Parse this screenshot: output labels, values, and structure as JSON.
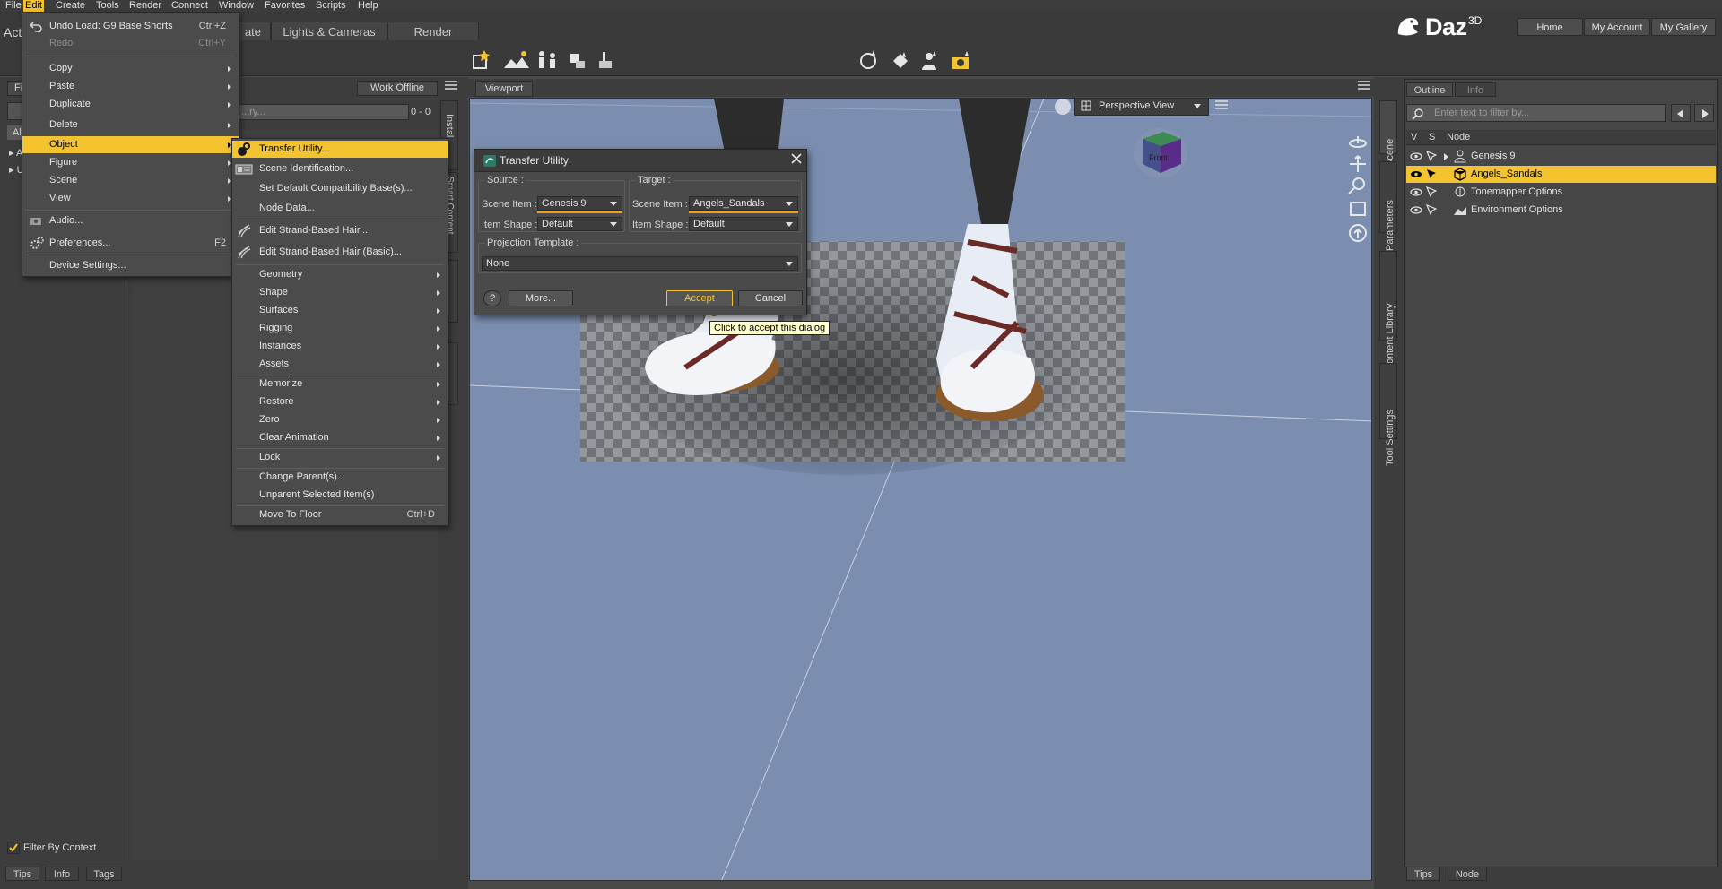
{
  "menubar": {
    "items": [
      "File",
      "Edit",
      "Create",
      "Tools",
      "Render",
      "Connect",
      "Window",
      "Favorites",
      "Scripts",
      "Help"
    ],
    "active": "Edit"
  },
  "header": {
    "partial_tab": "Acto",
    "tabs": [
      "ate",
      "Lights & Cameras",
      "Render"
    ],
    "logo": "Daz",
    "logo_sup": "3D",
    "nav_buttons": [
      "Home",
      "My Account",
      "My Gallery"
    ]
  },
  "left_panel": {
    "tab_partial": "Fil",
    "work_offline": "Work Offline",
    "filter_placeholder": "...ry...",
    "count": "0 - 0",
    "all_partial": "Al",
    "tree_items": [
      "Ar",
      "Ut"
    ],
    "filter_by_context": "Filter By Context",
    "bottom_tabs": [
      "Tips",
      "Info",
      "Tags"
    ],
    "side_tab": "Instal",
    "side_tab2": "Smart Content"
  },
  "edit_menu": {
    "items": [
      {
        "label": "Undo Load: G9 Base Shorts",
        "shortcut": "Ctrl+Z",
        "icon": "undo-icon"
      },
      {
        "label": "Redo",
        "shortcut": "Ctrl+Y",
        "disabled": true
      },
      {
        "label": "Copy",
        "submenu": true
      },
      {
        "label": "Paste",
        "submenu": true
      },
      {
        "label": "Duplicate",
        "submenu": true
      },
      {
        "label": "Delete",
        "submenu": true
      },
      {
        "label": "Object",
        "submenu": true,
        "highlighted": true
      },
      {
        "label": "Figure",
        "submenu": true
      },
      {
        "label": "Scene",
        "submenu": true
      },
      {
        "label": "View",
        "submenu": true
      },
      {
        "label": "Audio...",
        "icon": "audio-icon"
      },
      {
        "label": "Preferences...",
        "shortcut": "F2",
        "icon": "gears-icon"
      },
      {
        "label": "Device Settings..."
      }
    ]
  },
  "object_menu": {
    "items": [
      {
        "label": "Transfer Utility...",
        "highlighted": true,
        "icon": "transfer-icon"
      },
      {
        "label": "Scene Identification...",
        "icon": "scene-id-icon"
      },
      {
        "label": "Set Default Compatibility Base(s)..."
      },
      {
        "label": "Node Data..."
      },
      {
        "label": "Edit Strand-Based Hair...",
        "icon": "hair-icon"
      },
      {
        "label": "Edit Strand-Based Hair (Basic)...",
        "icon": "hair-icon"
      },
      {
        "label": "Geometry",
        "submenu": true
      },
      {
        "label": "Shape",
        "submenu": true
      },
      {
        "label": "Surfaces",
        "submenu": true
      },
      {
        "label": "Rigging",
        "submenu": true
      },
      {
        "label": "Instances",
        "submenu": true
      },
      {
        "label": "Assets",
        "submenu": true
      },
      {
        "label": "Memorize",
        "submenu": true
      },
      {
        "label": "Restore",
        "submenu": true
      },
      {
        "label": "Zero",
        "submenu": true
      },
      {
        "label": "Clear Animation",
        "submenu": true
      },
      {
        "label": "Lock",
        "submenu": true
      },
      {
        "label": "Change Parent(s)..."
      },
      {
        "label": "Unparent Selected Item(s)"
      },
      {
        "label": "Move To Floor",
        "shortcut": "Ctrl+D"
      }
    ]
  },
  "viewport": {
    "tab": "Viewport",
    "view_mode": "Perspective View",
    "cube_face": "Front"
  },
  "dialog": {
    "title": "Transfer Utility",
    "source": {
      "group": "Source :",
      "scene_item_label": "Scene Item :",
      "scene_item_value": "Genesis 9",
      "item_shape_label": "Item Shape :",
      "item_shape_value": "Default"
    },
    "target": {
      "group": "Target :",
      "scene_item_label": "Scene Item :",
      "scene_item_value": "Angels_Sandals",
      "item_shape_label": "Item Shape :",
      "item_shape_value": "Default"
    },
    "projection_label": "Projection Template :",
    "projection_value": "None",
    "help": "?",
    "more": "More...",
    "accept": "Accept",
    "cancel": "Cancel",
    "tooltip": "Click to accept this dialog"
  },
  "right_panel": {
    "tabs": [
      "Outline",
      "Info"
    ],
    "filter_placeholder": "Enter text to filter by...",
    "columns": [
      "V",
      "S",
      "Node"
    ],
    "nodes": [
      {
        "name": "Genesis 9",
        "icon": "figure-icon"
      },
      {
        "name": "Angels_Sandals",
        "icon": "prop-icon",
        "selected": true
      },
      {
        "name": "Tonemapper Options",
        "icon": "tonemapper-icon"
      },
      {
        "name": "Environment Options",
        "icon": "environment-icon"
      }
    ],
    "side_tabs": [
      "Scene",
      "Parameters",
      "Content Library",
      "Tool Settings"
    ],
    "bottom_tabs": [
      "Tips",
      "Node"
    ]
  },
  "colors": {
    "accent": "#f4c430",
    "viewport_bg": "#7b8eb0",
    "panel": "#4a4a4a"
  }
}
